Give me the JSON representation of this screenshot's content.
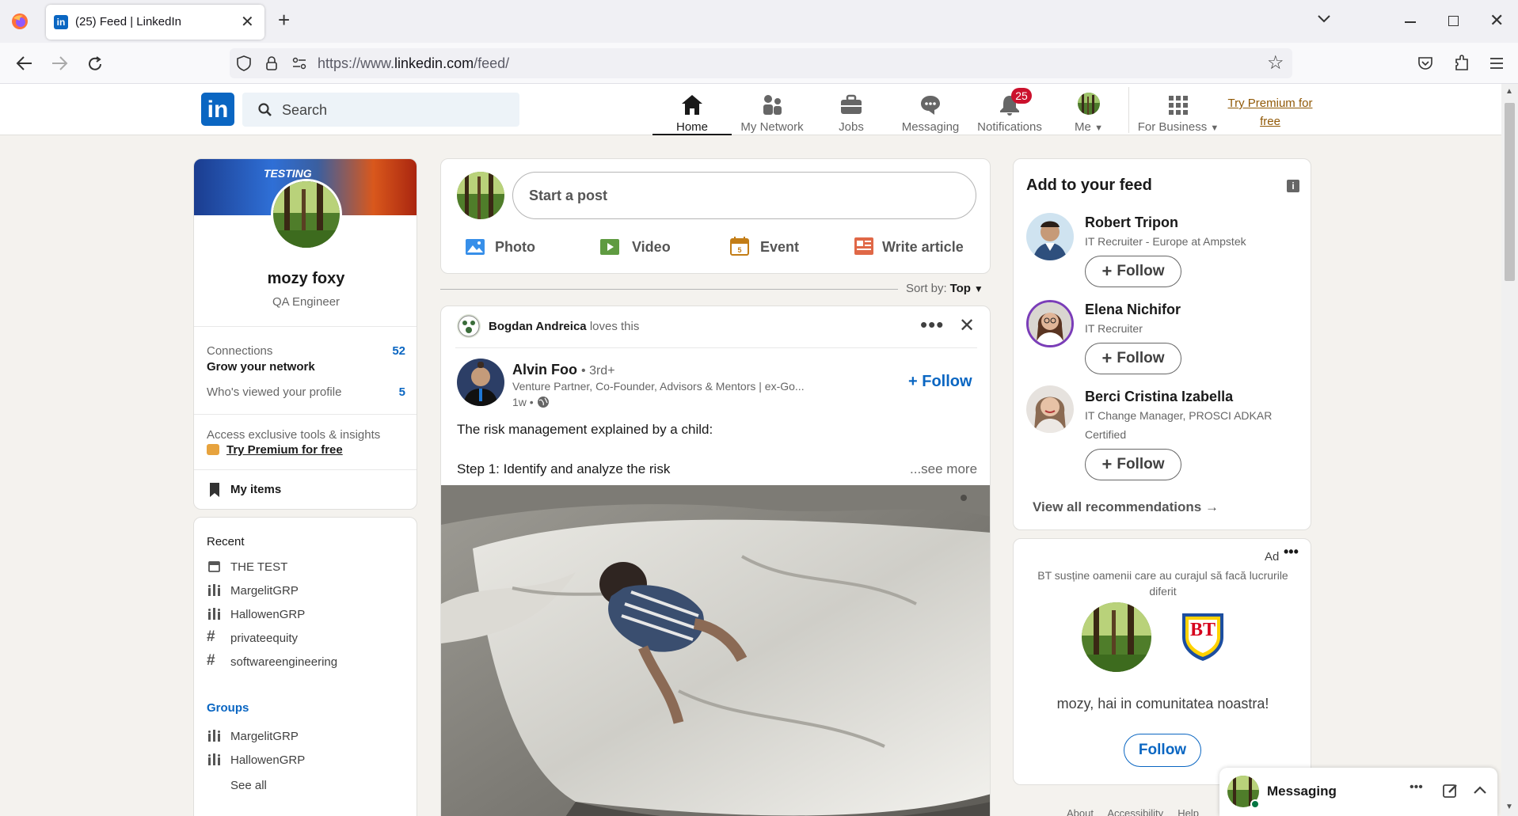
{
  "browser": {
    "tab_title": "(25) Feed | LinkedIn",
    "url_prefix": "https://www.",
    "url_host": "linkedin.com",
    "url_path": "/feed/"
  },
  "header": {
    "search_placeholder": "Search",
    "nav": [
      {
        "label": "Home",
        "icon": "home-icon"
      },
      {
        "label": "My Network",
        "icon": "network-icon"
      },
      {
        "label": "Jobs",
        "icon": "jobs-icon"
      },
      {
        "label": "Messaging",
        "icon": "messaging-icon"
      },
      {
        "label": "Notifications",
        "icon": "bell-icon",
        "badge": "25"
      },
      {
        "label": "Me",
        "icon": "avatar"
      },
      {
        "label": "For Business",
        "icon": "grid-icon"
      }
    ],
    "premium_line1": "Try Premium for",
    "premium_line2": "free"
  },
  "profile": {
    "banner_text": "TESTING",
    "name": "mozy foxy",
    "headline": "QA Engineer",
    "connections_label": "Connections",
    "connections_count": "52",
    "grow_label": "Grow your network",
    "viewed_label": "Who's viewed your profile",
    "viewed_count": "5",
    "exclusive_label": "Access exclusive tools & insights",
    "premium_link": "Try Premium for free",
    "my_items": "My items"
  },
  "recent": {
    "title": "Recent",
    "items": [
      {
        "label": "THE TEST",
        "icon": "calendar-icon"
      },
      {
        "label": "MargelitGRP",
        "icon": "group-icon"
      },
      {
        "label": "HallowenGRP",
        "icon": "group-icon"
      },
      {
        "label": "privateequity",
        "icon": "hashtag-icon"
      },
      {
        "label": "softwareengineering",
        "icon": "hashtag-icon"
      }
    ],
    "groups_title": "Groups",
    "groups": [
      {
        "label": "MargelitGRP"
      },
      {
        "label": "HallowenGRP"
      }
    ],
    "see_all": "See all"
  },
  "composer": {
    "placeholder": "Start a post",
    "actions": [
      {
        "label": "Photo",
        "icon": "photo-icon",
        "color": "#378fe9"
      },
      {
        "label": "Video",
        "icon": "video-icon",
        "color": "#5f9b41"
      },
      {
        "label": "Event",
        "icon": "event-icon",
        "color": "#c37d16"
      },
      {
        "label": "Write article",
        "icon": "article-icon",
        "color": "#e06847"
      }
    ]
  },
  "sort": {
    "label": "Sort by:",
    "value": "Top"
  },
  "post": {
    "reactor": "Bogdan Andreica",
    "reaction": "loves this",
    "author": "Alvin Foo",
    "degree": "• 3rd+",
    "subtitle": "Venture Partner, Co-Founder, Advisors & Mentors | ex-Go...",
    "time": "1w •",
    "follow": "Follow",
    "text1": "The risk management explained by a child:",
    "text2": "Step 1: Identify and analyze the risk",
    "see_more": "...see more"
  },
  "feed_suggestions": {
    "title": "Add to your feed",
    "people": [
      {
        "name": "Robert Tripon",
        "line1": "IT Recruiter - Europe at Ampstek",
        "line2": ""
      },
      {
        "name": "Elena Nichifor",
        "line1": "IT Recruiter",
        "line2": ""
      },
      {
        "name": "Berci Cristina Izabella",
        "line1": "IT Change Manager, PROSCI ADKAR",
        "line2": "Certified"
      }
    ],
    "follow_label": "Follow",
    "view_all": "View all recommendations"
  },
  "ad": {
    "label": "Ad",
    "line1": "BT susține oamenii care au curajul să facă lucrurile",
    "line2": "diferit",
    "logo_text": "BT",
    "message": "mozy, hai in comunitatea noastra!",
    "follow": "Follow"
  },
  "footer_links": [
    "About",
    "Accessibility",
    "Help"
  ],
  "messaging": {
    "label": "Messaging"
  },
  "colors": {
    "brand": "#0a66c2",
    "badge": "#cb112d"
  }
}
